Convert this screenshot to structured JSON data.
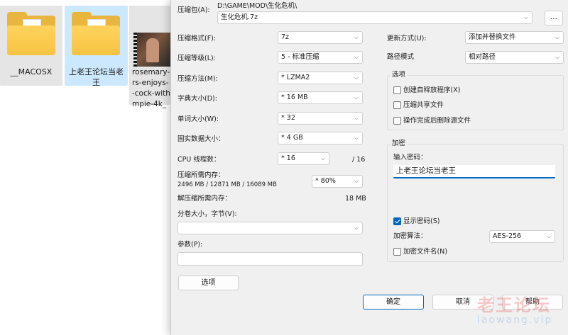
{
  "explorer": {
    "items": [
      {
        "name": "__MACOSX"
      },
      {
        "name_line1": "上老王论坛当老",
        "name_line2": "王"
      },
      {
        "name_lines": [
          "rosemary-",
          "rs-enjoys-",
          "-cock-with",
          "mpie-4k_"
        ]
      }
    ]
  },
  "dialog": {
    "archive_label": "压缩包(A):",
    "archive_path": "D:\\GAME\\MOD\\生化危机\\",
    "archive_name": "生化危机.7z",
    "browse_label": "...",
    "format_label": "压缩格式(F):",
    "format_value": "7z",
    "level_label": "压缩等级(L):",
    "level_value": "5 - 标准压缩",
    "method_label": "压缩方法(M):",
    "method_value": "* LZMA2",
    "dict_label": "字典大小(D):",
    "dict_value": "* 16 MB",
    "word_label": "单词大小(W):",
    "word_value": "* 32",
    "solid_label": "固实数据大小：",
    "solid_value": "* 4 GB",
    "cpu_label": "CPU 线程数：",
    "cpu_value": "* 16",
    "cpu_max": "/ 16",
    "mem_comp_label": "压缩所需内存：",
    "mem_comp_detail": "2496 MB / 12871 MB / 16089 MB",
    "mem_comp_value": "* 80%",
    "mem_decomp_label": "解压缩所需内存：",
    "mem_decomp_value": "18 MB",
    "split_label": "分卷大小，字节(V):",
    "split_value": "",
    "params_label": "参数(P):",
    "params_value": "",
    "options_button": "选项",
    "update_label": "更新方式(U):",
    "update_value": "添加并替换文件",
    "path_label": "路径模式",
    "path_value": "相对路径",
    "options_group": "选项",
    "opt_sfx": "创建自释放程序(X)",
    "opt_shared": "压缩共享文件",
    "opt_delete": "操作完成后删除源文件",
    "encrypt_group": "加密",
    "password_label": "输入密码：",
    "password_value": "上老王论坛当老王",
    "show_password": "显示密码(S)",
    "enc_method_label": "加密算法：",
    "enc_method_value": "AES-256",
    "enc_names": "加密文件名(N)",
    "ok_button": "确定",
    "cancel_button": "取消",
    "help_button": "帮助"
  },
  "watermark": {
    "text": "老王论坛",
    "sub": "laowang.vip"
  }
}
